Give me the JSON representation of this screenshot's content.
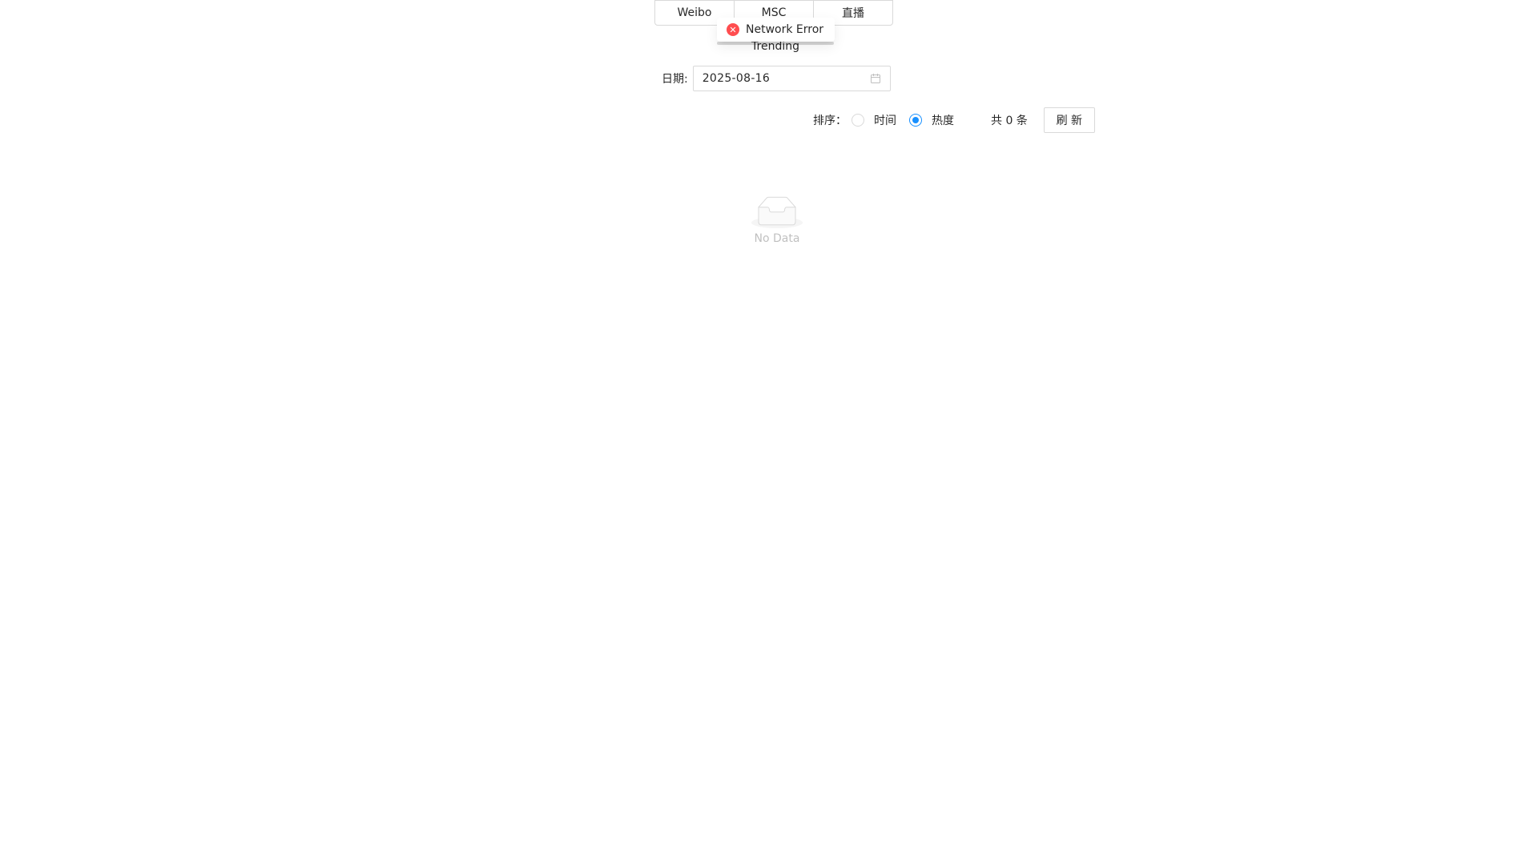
{
  "tabs": [
    {
      "label": "Weibo"
    },
    {
      "label": "MSC"
    },
    {
      "label": "直播"
    }
  ],
  "toast": {
    "icon": "error-circle-icon",
    "message": "Network Error",
    "color": "#ff4d4f"
  },
  "section": {
    "title": "Trending"
  },
  "filter": {
    "date_label": "日期:",
    "date_value": "2025-08-16",
    "calendar_icon": "calendar-icon"
  },
  "sort": {
    "label": "排序：",
    "options": [
      {
        "label": "时间",
        "selected": false
      },
      {
        "label": "热度",
        "selected": true
      }
    ],
    "count_text": "共 0 条",
    "refresh_label": "刷 新",
    "accent": "#1890ff"
  },
  "empty": {
    "icon": "empty-inbox-icon",
    "text": "No Data"
  }
}
